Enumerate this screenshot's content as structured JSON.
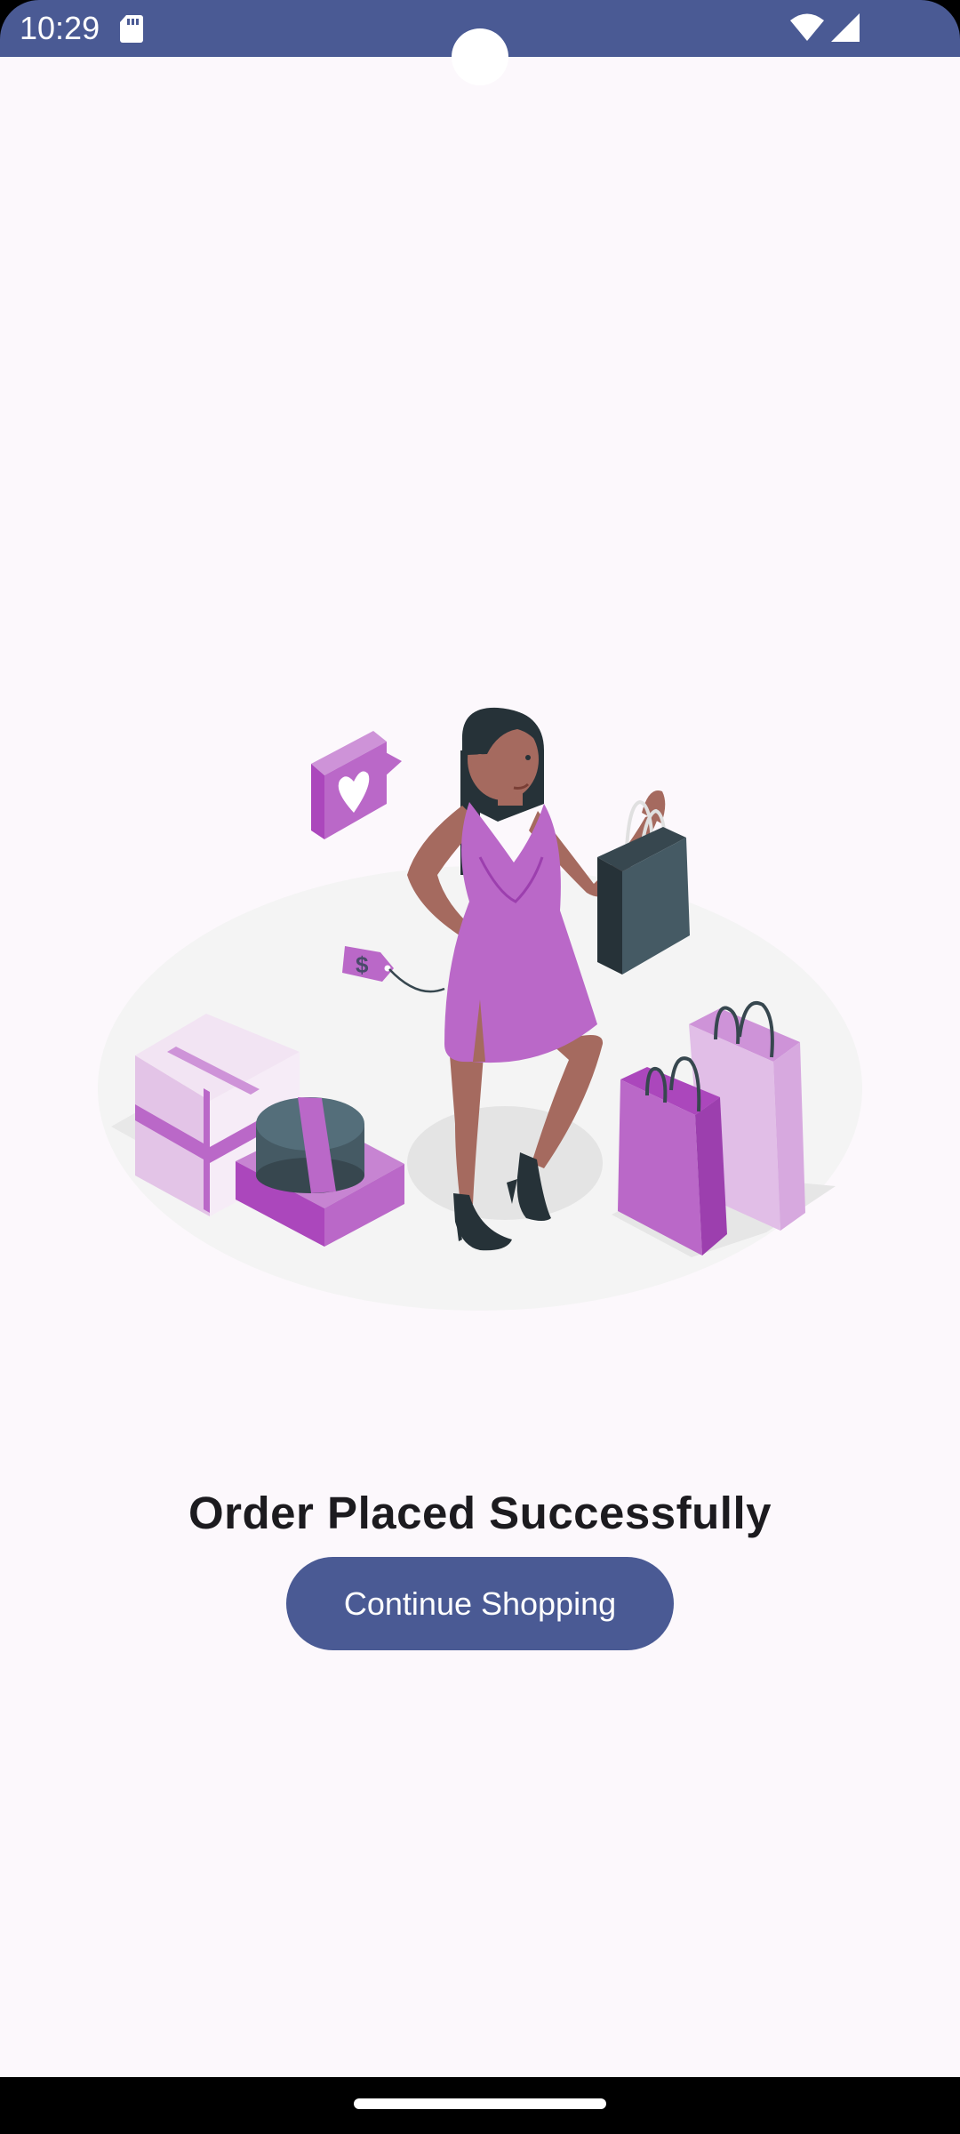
{
  "status_bar": {
    "time": "10:29",
    "background_color": "#4a5a94",
    "icons": [
      "sd-card-icon",
      "wifi-icon",
      "cell-signal-icon"
    ]
  },
  "illustration": {
    "name": "shopping-woman-illustration",
    "price_tag_symbol": "$",
    "accent_color": "#ba68c8"
  },
  "main": {
    "title": "Order Placed Successfully",
    "continue_button_label": "Continue Shopping"
  },
  "colors": {
    "background": "#fcf8fc",
    "primary": "#4a5a94",
    "title_text": "#1c1b1f"
  }
}
